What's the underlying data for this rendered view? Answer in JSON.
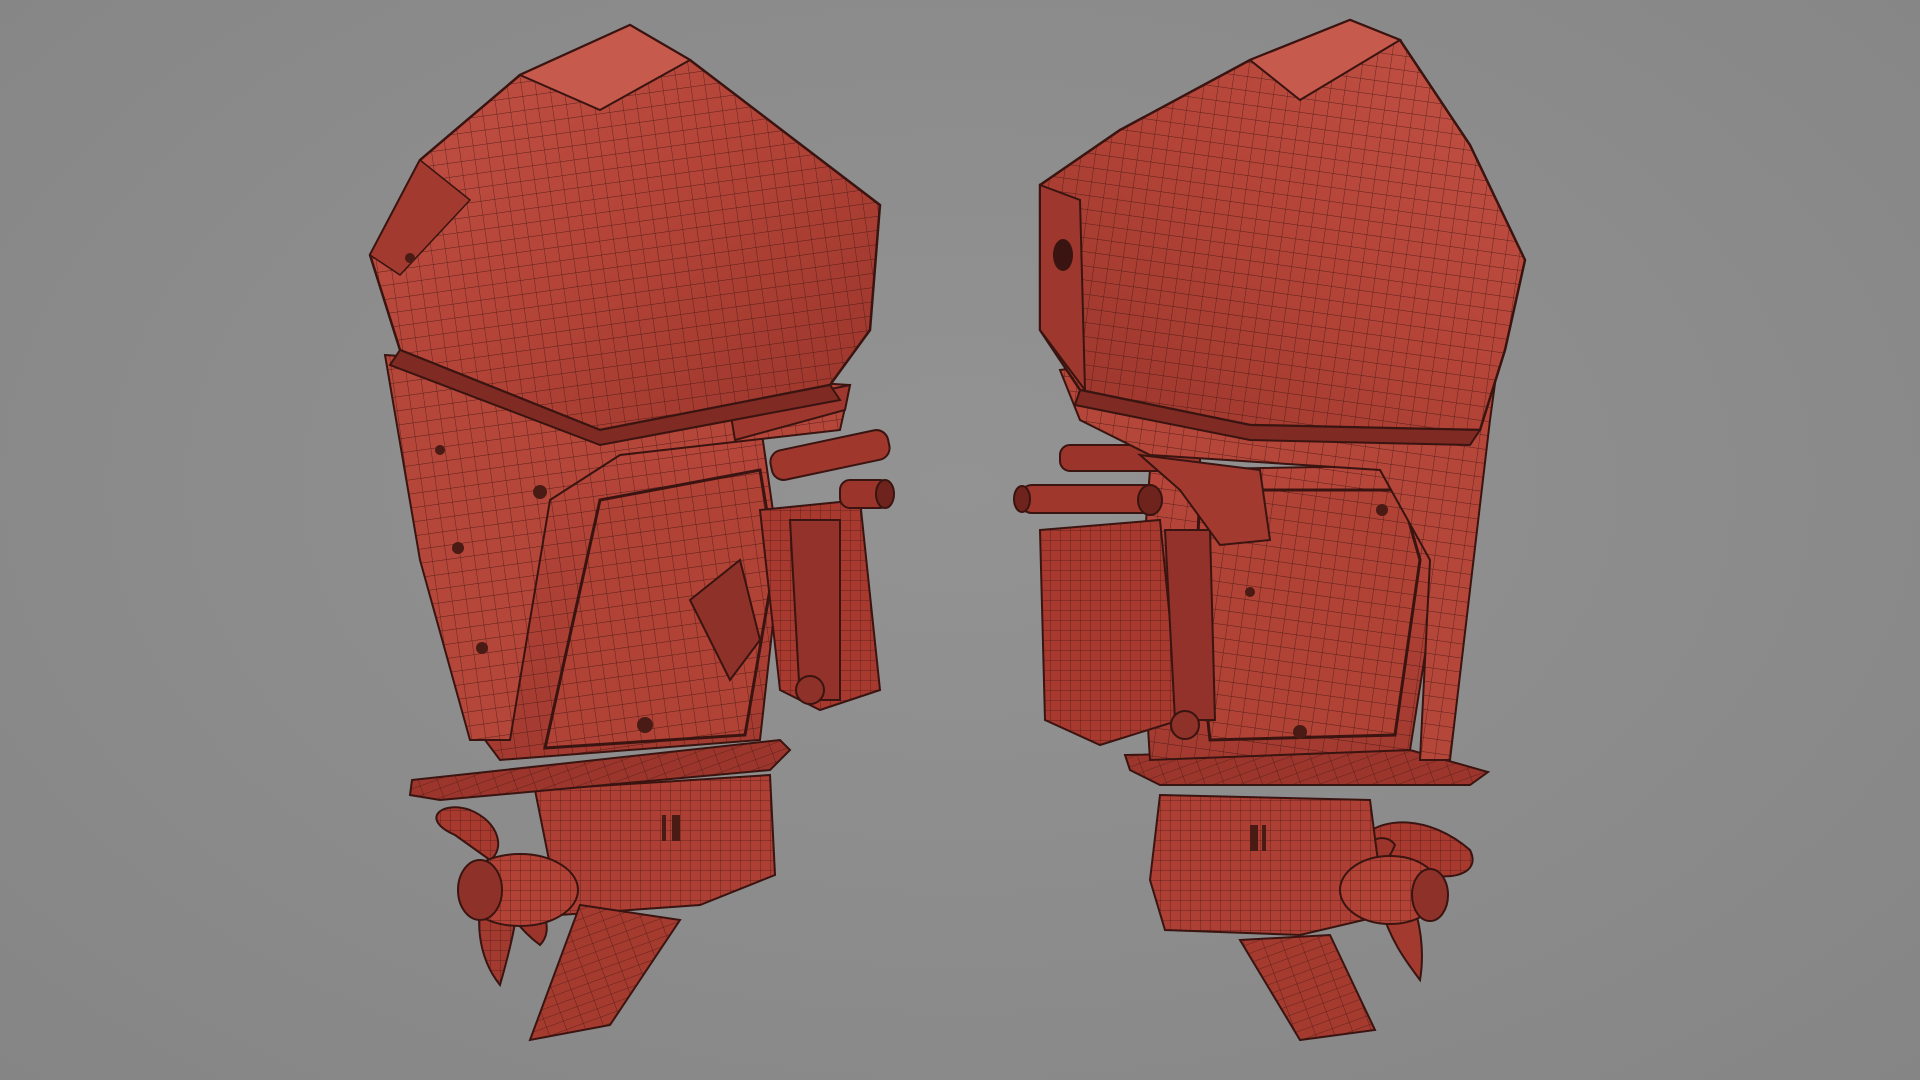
{
  "scene": {
    "background": "#8b8b8b",
    "models": [
      {
        "name": "outboard-motor-left",
        "view": "front-three-quarter",
        "colors": {
          "fill": "#b6473c",
          "fill_light": "#c9584b",
          "fill_dark": "#8e3129",
          "wire": "#3a1410"
        }
      },
      {
        "name": "outboard-motor-right",
        "view": "rear-three-quarter",
        "colors": {
          "fill": "#b6473c",
          "fill_light": "#c9584b",
          "fill_dark": "#8e3129",
          "wire": "#3a1410"
        }
      }
    ]
  }
}
